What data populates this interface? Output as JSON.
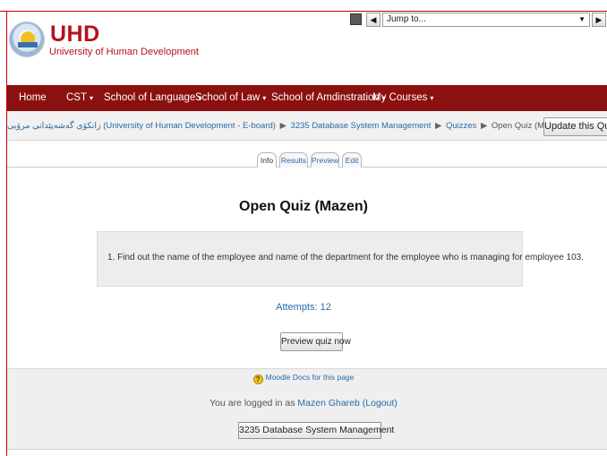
{
  "header": {
    "logo_title": "UHD",
    "logo_subtitle": "University of Human Development",
    "jump_placeholder": "Jump to...",
    "jump_prev": "◀",
    "jump_next": "▶",
    "jump_caret": "▼"
  },
  "nav": {
    "items": [
      {
        "label": "Home",
        "dropdown": false
      },
      {
        "label": "CST",
        "dropdown": true
      },
      {
        "label": "School of Language",
        "dropdown": true
      },
      {
        "label": "School of Law",
        "dropdown": true
      },
      {
        "label": "School of Amdinstration",
        "dropdown": true
      },
      {
        "label": "My Courses",
        "dropdown": true
      }
    ],
    "chevron": "▾"
  },
  "breadcrumb": {
    "items": [
      "زانكۆی گه‌شه‌پێدانی مرۆیی (University of Human Development - E-board)",
      "3235 Database System Management",
      "Quizzes",
      "Open Quiz (Mazen)"
    ],
    "separator": "▶",
    "update_button": "Update this Quiz"
  },
  "tabs": [
    "Info",
    "Results",
    "Preview",
    "Edit"
  ],
  "main": {
    "title": "Open Quiz (Mazen)",
    "question": "1.  Find out the name of the employee and name of the department for the employee who is managing for employee 103.",
    "attempts": "Attempts: 12",
    "preview_button": "Preview quiz now"
  },
  "footer": {
    "help_icon": "?",
    "docs_link": "Moodle Docs for this page",
    "logged_prefix": "You are logged in as",
    "user_name": "Mazen Ghareb",
    "logout": "(Logout)",
    "course_button": "3235 Database System Management"
  }
}
